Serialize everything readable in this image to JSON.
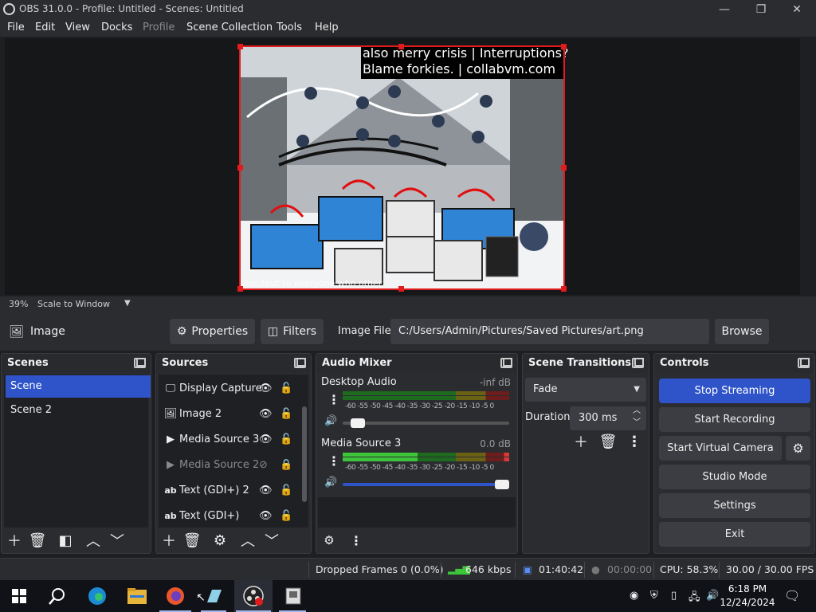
{
  "window": {
    "title": "OBS 31.0.0 - Profile: Untitled - Scenes: Untitled",
    "minimize": "—",
    "restore": "❐",
    "close": "✕"
  },
  "menu": [
    "File",
    "Edit",
    "View",
    "Docks",
    "Profile",
    "Scene Collection",
    "Tools",
    "Help"
  ],
  "preview": {
    "overlay_line1": "also merry crisis | Interruptions?",
    "overlay_line2": "Blame forkies. | collabvm.com",
    "caption": "shoutout to everyone who other"
  },
  "zoom": {
    "percent": "39%",
    "mode": "Scale to Window"
  },
  "source_toolbar": {
    "source_name": "Image",
    "properties": "Properties",
    "filters": "Filters",
    "field_label": "Image File",
    "field_value": "C:/Users/Admin/Pictures/Saved Pictures/art.png",
    "browse": "Browse"
  },
  "scenes": {
    "title": "Scenes",
    "items": [
      "Scene",
      "Scene 2"
    ]
  },
  "sources": {
    "title": "Sources",
    "items": [
      {
        "label": "Display Capture",
        "icon": "monitor-icon",
        "visible": true
      },
      {
        "label": "Image 2",
        "icon": "image-icon",
        "visible": true
      },
      {
        "label": "Media Source 3",
        "icon": "play-icon",
        "visible": true
      },
      {
        "label": "Media Source 2",
        "icon": "play-icon",
        "visible": false
      },
      {
        "label": "Text (GDI+) 2",
        "icon": "text-icon",
        "visible": true
      },
      {
        "label": "Text (GDI+)",
        "icon": "text-icon",
        "visible": true
      }
    ]
  },
  "mixer": {
    "title": "Audio Mixer",
    "scale": "-60 -55 -50 -45 -40 -35 -30 -25 -20 -15 -10 -5  0",
    "channels": [
      {
        "name": "Desktop Audio",
        "db": "-inf dB",
        "volume": 0.05
      },
      {
        "name": "Media Source 3",
        "db": "0.0 dB",
        "volume": 1.0
      }
    ]
  },
  "transitions": {
    "title": "Scene Transitions",
    "selected": "Fade",
    "duration_label": "Duration",
    "duration_value": "300 ms"
  },
  "controls": {
    "title": "Controls",
    "stop_streaming": "Stop Streaming",
    "start_recording": "Start Recording",
    "start_virtual_camera": "Start Virtual Camera",
    "studio_mode": "Studio Mode",
    "settings": "Settings",
    "exit": "Exit"
  },
  "status": {
    "dropped_frames": "Dropped Frames 0 (0.0%)",
    "bitrate": "646 kbps",
    "stream_time": "01:40:42",
    "record_time": "00:00:00",
    "cpu": "CPU: 58.3%",
    "fps": "30.00 / 30.00 FPS"
  },
  "taskbar": {
    "time": "6:18 PM",
    "date": "12/24/2024"
  },
  "colors": {
    "accent": "#2f54c9",
    "selection": "#e21c1c",
    "meter_green": "#3ec43a",
    "meter_yellow": "#d6c22c",
    "meter_red": "#d83a3a"
  }
}
